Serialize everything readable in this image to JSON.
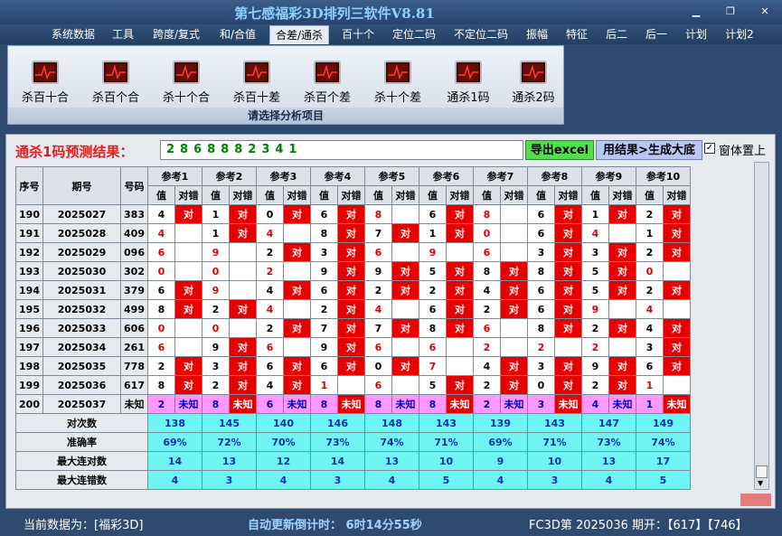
{
  "app": {
    "title": "第七感福彩3D排列三软件V8.81"
  },
  "menu": [
    "系统数据",
    "工具",
    "跨度/复式",
    "和/合值",
    "合差/通杀",
    "百十个",
    "定位二码",
    "不定位二码",
    "振幅",
    "特征",
    "后二",
    "后一",
    "计划",
    "计划2"
  ],
  "ribbon": {
    "buttons": [
      "杀百十合",
      "杀百个合",
      "杀十个合",
      "杀百十差",
      "杀百个差",
      "杀十个差",
      "通杀1码",
      "通杀2码"
    ],
    "caption": "请选择分析项目"
  },
  "prediction": {
    "label": "通杀1码预测结果：",
    "value": "2868882341",
    "export_button": "导出excel",
    "generate_button": "用结果>生成大底",
    "topmost_label": "窗体置上"
  },
  "table": {
    "headers": {
      "seq": "序号",
      "issue": "期号",
      "code": "号码",
      "value": "值",
      "correct": "对错"
    },
    "refs": [
      "参考1",
      "参考2",
      "参考3",
      "参考4",
      "参考5",
      "参考6",
      "参考7",
      "参考8",
      "参考9",
      "参考10"
    ],
    "rows": [
      {
        "seq": "190",
        "issue": "2025027",
        "code": "383",
        "cells": [
          [
            "4",
            0,
            "对",
            1
          ],
          [
            "1",
            0,
            "对",
            1
          ],
          [
            "0",
            0,
            "对",
            1
          ],
          [
            "6",
            0,
            "对",
            1
          ],
          [
            "8",
            1,
            "",
            0
          ],
          [
            "6",
            0,
            "对",
            1
          ],
          [
            "8",
            1,
            "",
            0
          ],
          [
            "6",
            0,
            "对",
            1
          ],
          [
            "1",
            0,
            "对",
            1
          ],
          [
            "2",
            0,
            "对",
            1
          ]
        ]
      },
      {
        "seq": "191",
        "issue": "2025028",
        "code": "409",
        "cells": [
          [
            "4",
            1,
            "",
            0
          ],
          [
            "1",
            0,
            "对",
            1
          ],
          [
            "4",
            1,
            "",
            0
          ],
          [
            "8",
            0,
            "对",
            1
          ],
          [
            "7",
            0,
            "对",
            1
          ],
          [
            "1",
            0,
            "对",
            1
          ],
          [
            "0",
            1,
            "",
            0
          ],
          [
            "6",
            0,
            "对",
            1
          ],
          [
            "4",
            1,
            "",
            0
          ],
          [
            "1",
            0,
            "对",
            1
          ]
        ]
      },
      {
        "seq": "192",
        "issue": "2025029",
        "code": "096",
        "cells": [
          [
            "6",
            1,
            "",
            0
          ],
          [
            "9",
            1,
            "",
            0
          ],
          [
            "2",
            0,
            "对",
            1
          ],
          [
            "3",
            0,
            "对",
            1
          ],
          [
            "6",
            1,
            "",
            0
          ],
          [
            "9",
            1,
            "",
            0
          ],
          [
            "6",
            1,
            "",
            0
          ],
          [
            "3",
            0,
            "对",
            1
          ],
          [
            "3",
            0,
            "对",
            1
          ],
          [
            "2",
            0,
            "对",
            1
          ]
        ]
      },
      {
        "seq": "193",
        "issue": "2025030",
        "code": "302",
        "cells": [
          [
            "0",
            1,
            "",
            0
          ],
          [
            "0",
            1,
            "",
            0
          ],
          [
            "2",
            1,
            "",
            0
          ],
          [
            "9",
            0,
            "对",
            1
          ],
          [
            "9",
            0,
            "对",
            1
          ],
          [
            "5",
            0,
            "对",
            1
          ],
          [
            "8",
            0,
            "对",
            1
          ],
          [
            "8",
            0,
            "对",
            1
          ],
          [
            "5",
            0,
            "对",
            1
          ],
          [
            "0",
            1,
            "",
            0
          ]
        ]
      },
      {
        "seq": "194",
        "issue": "2025031",
        "code": "379",
        "cells": [
          [
            "6",
            0,
            "对",
            1
          ],
          [
            "9",
            1,
            "",
            0
          ],
          [
            "4",
            0,
            "对",
            1
          ],
          [
            "6",
            0,
            "对",
            1
          ],
          [
            "2",
            0,
            "对",
            1
          ],
          [
            "2",
            0,
            "对",
            1
          ],
          [
            "4",
            0,
            "对",
            1
          ],
          [
            "6",
            0,
            "对",
            1
          ],
          [
            "5",
            0,
            "对",
            1
          ],
          [
            "2",
            0,
            "对",
            1
          ]
        ]
      },
      {
        "seq": "195",
        "issue": "2025032",
        "code": "499",
        "cells": [
          [
            "8",
            0,
            "对",
            1
          ],
          [
            "2",
            0,
            "对",
            1
          ],
          [
            "4",
            1,
            "",
            0
          ],
          [
            "2",
            0,
            "对",
            1
          ],
          [
            "4",
            1,
            "",
            0
          ],
          [
            "6",
            0,
            "对",
            1
          ],
          [
            "2",
            0,
            "对",
            1
          ],
          [
            "6",
            0,
            "对",
            1
          ],
          [
            "9",
            1,
            "",
            0
          ],
          [
            "4",
            1,
            "",
            0
          ]
        ]
      },
      {
        "seq": "196",
        "issue": "2025033",
        "code": "606",
        "cells": [
          [
            "0",
            1,
            "",
            0
          ],
          [
            "0",
            1,
            "",
            0
          ],
          [
            "2",
            0,
            "对",
            1
          ],
          [
            "7",
            0,
            "对",
            1
          ],
          [
            "7",
            0,
            "对",
            1
          ],
          [
            "8",
            0,
            "对",
            1
          ],
          [
            "6",
            1,
            "",
            0
          ],
          [
            "8",
            0,
            "对",
            1
          ],
          [
            "2",
            0,
            "对",
            1
          ],
          [
            "4",
            0,
            "对",
            1
          ]
        ]
      },
      {
        "seq": "197",
        "issue": "2025034",
        "code": "261",
        "cells": [
          [
            "6",
            1,
            "",
            0
          ],
          [
            "9",
            0,
            "对",
            1
          ],
          [
            "6",
            1,
            "",
            0
          ],
          [
            "9",
            0,
            "对",
            1
          ],
          [
            "6",
            1,
            "",
            0
          ],
          [
            "6",
            1,
            "",
            0
          ],
          [
            "2",
            1,
            "",
            0
          ],
          [
            "2",
            1,
            "",
            0
          ],
          [
            "2",
            1,
            "",
            0
          ],
          [
            "3",
            0,
            "对",
            1
          ]
        ]
      },
      {
        "seq": "198",
        "issue": "2025035",
        "code": "778",
        "cells": [
          [
            "2",
            0,
            "对",
            1
          ],
          [
            "3",
            0,
            "对",
            1
          ],
          [
            "6",
            0,
            "对",
            1
          ],
          [
            "6",
            0,
            "对",
            1
          ],
          [
            "0",
            0,
            "对",
            1
          ],
          [
            "7",
            1,
            "",
            0
          ],
          [
            "4",
            0,
            "对",
            1
          ],
          [
            "3",
            0,
            "对",
            1
          ],
          [
            "9",
            0,
            "对",
            1
          ],
          [
            "6",
            0,
            "对",
            1
          ]
        ]
      },
      {
        "seq": "199",
        "issue": "2025036",
        "code": "617",
        "cells": [
          [
            "8",
            0,
            "对",
            1
          ],
          [
            "2",
            0,
            "对",
            1
          ],
          [
            "4",
            0,
            "对",
            1
          ],
          [
            "1",
            1,
            "",
            0
          ],
          [
            "6",
            1,
            "",
            0
          ],
          [
            "5",
            0,
            "对",
            1
          ],
          [
            "2",
            0,
            "对",
            1
          ],
          [
            "0",
            0,
            "对",
            1
          ],
          [
            "2",
            0,
            "对",
            1
          ],
          [
            "1",
            1,
            "",
            0
          ]
        ]
      }
    ],
    "predict_row": {
      "seq": "200",
      "issue": "2025037",
      "code": "未知",
      "cells": [
        [
          "2",
          "未知"
        ],
        [
          "8",
          "未知"
        ],
        [
          "6",
          "未知"
        ],
        [
          "8",
          "未知"
        ],
        [
          "8",
          "未知"
        ],
        [
          "8",
          "未知"
        ],
        [
          "2",
          "未知"
        ],
        [
          "3",
          "未知"
        ],
        [
          "4",
          "未知"
        ],
        [
          "1",
          "未知"
        ]
      ]
    },
    "stats": [
      {
        "label": "对次数",
        "values": [
          "138",
          "145",
          "140",
          "146",
          "148",
          "143",
          "139",
          "143",
          "147",
          "149"
        ]
      },
      {
        "label": "准确率",
        "values": [
          "69%",
          "72%",
          "70%",
          "73%",
          "74%",
          "71%",
          "69%",
          "71%",
          "73%",
          "74%"
        ]
      },
      {
        "label": "最大连对数",
        "values": [
          "14",
          "13",
          "12",
          "14",
          "13",
          "10",
          "9",
          "10",
          "13",
          "17"
        ]
      },
      {
        "label": "最大连错数",
        "values": [
          "4",
          "3",
          "4",
          "3",
          "4",
          "5",
          "4",
          "3",
          "4",
          "5"
        ]
      }
    ]
  },
  "status": {
    "current_data": "当前数据为：[福彩3D]",
    "countdown": "自动更新倒计时： 6时14分55秒",
    "latest": "FC3D第 2025036 期开：【617】【746】"
  }
}
